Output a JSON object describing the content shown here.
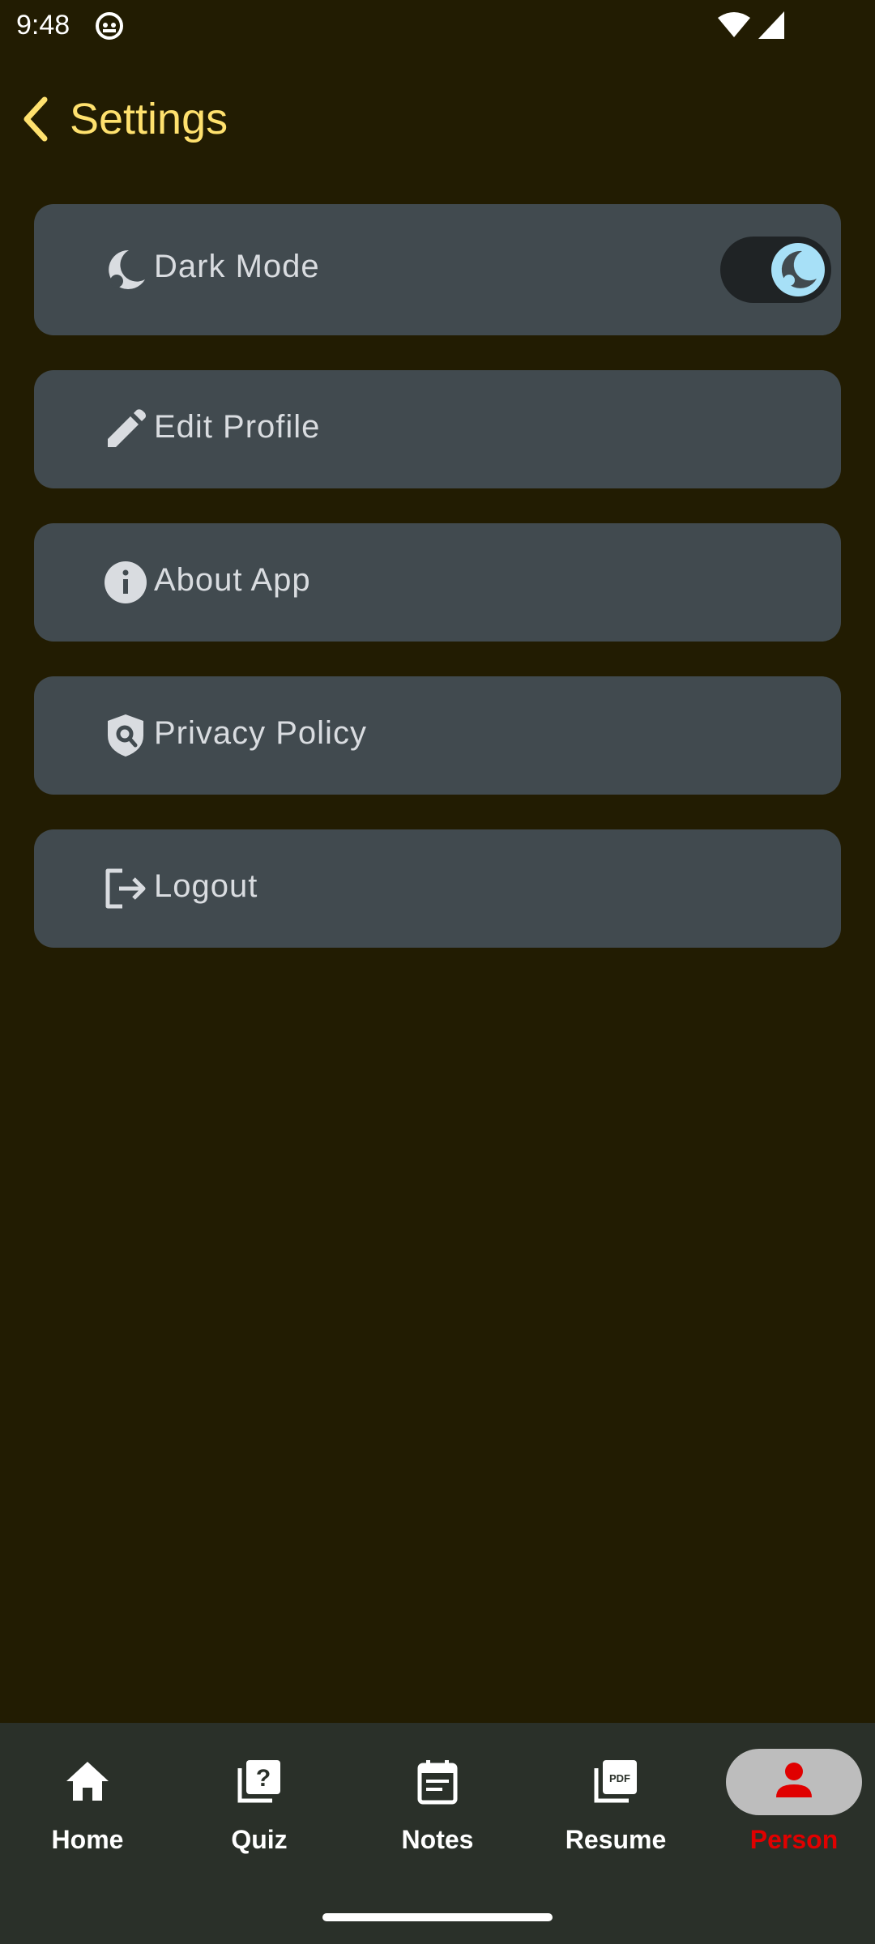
{
  "status_bar": {
    "time": "9:48"
  },
  "app_bar": {
    "title": "Settings"
  },
  "settings": {
    "dark_mode_label": "Dark Mode",
    "dark_mode_enabled": true,
    "edit_profile_label": "Edit Profile",
    "about_app_label": "About App",
    "privacy_policy_label": "Privacy Policy",
    "logout_label": "Logout"
  },
  "bottom_nav": {
    "items": [
      {
        "label": "Home",
        "icon": "home-icon"
      },
      {
        "label": "Quiz",
        "icon": "quiz-icon"
      },
      {
        "label": "Notes",
        "icon": "notes-icon"
      },
      {
        "label": "Resume",
        "icon": "pdf-icon"
      },
      {
        "label": "Person",
        "icon": "person-icon"
      }
    ],
    "active": "Person"
  },
  "colors": {
    "background": "#221c02",
    "accent": "#ffe16e",
    "card": "#414a4f",
    "nav_active": "#e00000"
  }
}
